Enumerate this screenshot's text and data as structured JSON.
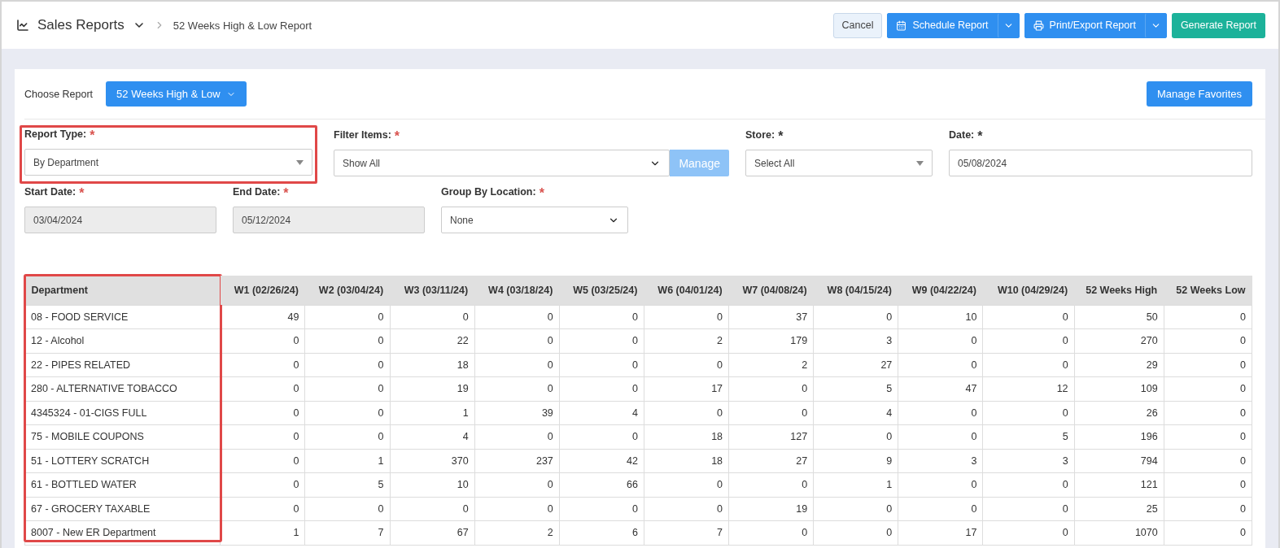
{
  "header": {
    "title": "Sales Reports",
    "breadcrumb": "52 Weeks High & Low Report",
    "buttons": [
      {
        "kind": "cancel",
        "label": "Cancel"
      },
      {
        "kind": "schedule",
        "label": "Schedule Report"
      },
      {
        "kind": "print",
        "label": "Print/Export Report"
      },
      {
        "kind": "generate",
        "label": "Generate Report"
      }
    ]
  },
  "chooser": {
    "label": "Choose Report",
    "value": "52 Weeks High & Low",
    "favorites": "Manage Favorites"
  },
  "form_rows": [
    [
      {
        "kind": "dropdown",
        "label": "Report Type:",
        "asterisk": {
          "text": "*",
          "color": "#d9534f"
        },
        "value": "By Department",
        "disabled": false,
        "highlighted": true
      },
      {
        "kind": "select-manage",
        "label": "Filter Items:",
        "asterisk": {
          "text": "*",
          "color": "#d9534f"
        },
        "value": "Show All",
        "button": "Manage",
        "disabled": false,
        "highlighted": false
      },
      {
        "kind": "dropdown",
        "label": "Store:",
        "asterisk": {
          "text": "*",
          "color": "#333333"
        },
        "value": "Select All",
        "disabled": false,
        "highlighted": false
      },
      {
        "kind": "input",
        "label": "Date:",
        "asterisk": {
          "text": "*",
          "color": "#333333"
        },
        "value": "05/08/2024",
        "disabled": false,
        "highlighted": false
      }
    ],
    [
      {
        "kind": "input",
        "label": "Start Date:",
        "asterisk": {
          "text": "*",
          "color": "#d9534f"
        },
        "value": "03/04/2024",
        "disabled": true,
        "highlighted": false
      },
      {
        "kind": "input",
        "label": "End Date:",
        "asterisk": {
          "text": "*",
          "color": "#d9534f"
        },
        "value": "05/12/2024",
        "disabled": true,
        "highlighted": false
      },
      {
        "kind": "select",
        "label": "Group By Location:",
        "asterisk": {
          "text": "*",
          "color": "#d9534f"
        },
        "value": "None",
        "disabled": false,
        "highlighted": false
      }
    ]
  ],
  "table": {
    "columns": [
      {
        "label": "Department",
        "highlighted": true
      },
      {
        "label": "W1 (02/26/24)",
        "highlighted": false
      },
      {
        "label": "W2 (03/04/24)",
        "highlighted": false
      },
      {
        "label": "W3 (03/11/24)",
        "highlighted": false
      },
      {
        "label": "W4 (03/18/24)",
        "highlighted": false
      },
      {
        "label": "W5 (03/25/24)",
        "highlighted": false
      },
      {
        "label": "W6 (04/01/24)",
        "highlighted": false
      },
      {
        "label": "W7 (04/08/24)",
        "highlighted": false
      },
      {
        "label": "W8 (04/15/24)",
        "highlighted": false
      },
      {
        "label": "W9 (04/22/24)",
        "highlighted": false
      },
      {
        "label": "W10 (04/29/24)",
        "highlighted": false
      },
      {
        "label": "52 Weeks High",
        "highlighted": false
      },
      {
        "label": "52 Weeks Low",
        "highlighted": false
      }
    ],
    "rows": [
      [
        "08 - FOOD SERVICE",
        "49",
        "0",
        "0",
        "0",
        "0",
        "0",
        "37",
        "0",
        "10",
        "0",
        "50",
        "0"
      ],
      [
        "12 - Alcohol",
        "0",
        "0",
        "22",
        "0",
        "0",
        "2",
        "179",
        "3",
        "0",
        "0",
        "270",
        "0"
      ],
      [
        "22 - PIPES RELATED",
        "0",
        "0",
        "18",
        "0",
        "0",
        "0",
        "2",
        "27",
        "0",
        "0",
        "29",
        "0"
      ],
      [
        "280 - ALTERNATIVE TOBACCO",
        "0",
        "0",
        "19",
        "0",
        "0",
        "17",
        "0",
        "5",
        "47",
        "12",
        "109",
        "0"
      ],
      [
        "4345324 - 01-CIGS FULL",
        "0",
        "0",
        "1",
        "39",
        "4",
        "0",
        "0",
        "4",
        "0",
        "0",
        "26",
        "0"
      ],
      [
        "75 - MOBILE COUPONS",
        "0",
        "0",
        "4",
        "0",
        "0",
        "18",
        "127",
        "0",
        "0",
        "5",
        "196",
        "0"
      ],
      [
        "51 - LOTTERY SCRATCH",
        "0",
        "1",
        "370",
        "237",
        "42",
        "18",
        "27",
        "9",
        "3",
        "3",
        "794",
        "0"
      ],
      [
        "61 - BOTTLED WATER",
        "0",
        "5",
        "10",
        "0",
        "66",
        "0",
        "0",
        "1",
        "0",
        "0",
        "121",
        "0"
      ],
      [
        "67 - GROCERY TAXABLE",
        "0",
        "0",
        "0",
        "0",
        "0",
        "0",
        "19",
        "0",
        "0",
        "0",
        "25",
        "0"
      ],
      [
        "8007 - New ER Department",
        "1",
        "7",
        "67",
        "2",
        "6",
        "7",
        "0",
        "0",
        "17",
        "0",
        "1070",
        "0"
      ]
    ]
  }
}
